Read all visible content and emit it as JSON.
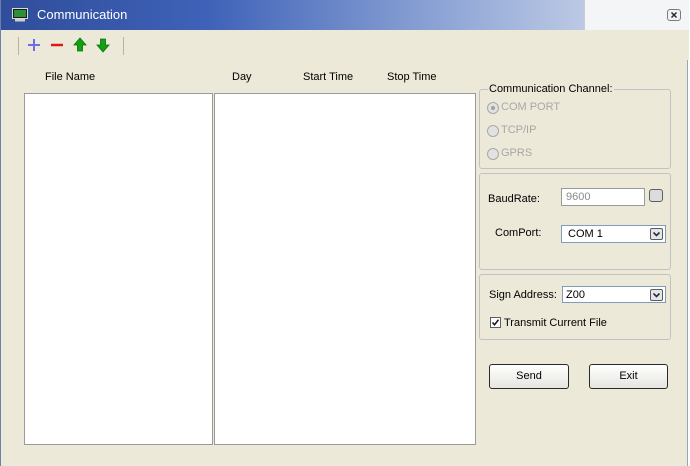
{
  "window": {
    "title": "Communication"
  },
  "toolbar": {
    "icons": [
      "add-icon",
      "remove-icon",
      "move-up-icon",
      "move-down-icon"
    ],
    "colors": {
      "add": "#6e6ee6",
      "remove": "#e01818",
      "arrows": "#12a112"
    }
  },
  "file_list": {
    "columns": [
      "File Name",
      "Day",
      "Start Time",
      "Stop Time"
    ]
  },
  "channel": {
    "label": "Communication Channel:",
    "options": [
      "COM PORT",
      "TCP/IP",
      "GPRS"
    ],
    "selected": "COM PORT"
  },
  "serial": {
    "baudrate_label": "BaudRate:",
    "baudrate_value": "9600",
    "comport_label": "ComPort:",
    "comport_value": "COM 1"
  },
  "sign": {
    "address_label": "Sign Address:",
    "address_value": "Z00",
    "transmit_label": "Transmit Current File",
    "transmit_checked": true
  },
  "actions": {
    "send_label": "Send",
    "exit_label": "Exit"
  }
}
